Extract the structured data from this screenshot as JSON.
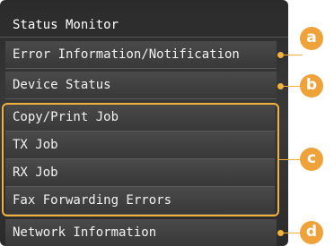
{
  "screen": {
    "title": "Status Monitor",
    "items": [
      {
        "label": "Error Information/Notification"
      },
      {
        "label": "Device Status"
      },
      {
        "label": "Copy/Print Job"
      },
      {
        "label": "TX Job"
      },
      {
        "label": "RX Job"
      },
      {
        "label": "Fax Forwarding Errors"
      },
      {
        "label": "Network Information"
      }
    ]
  },
  "callouts": [
    "a",
    "b",
    "c",
    "d"
  ],
  "colors": {
    "accent": "#f0a23a",
    "screen_bg": "#333333",
    "text": "#f2f2f2"
  }
}
